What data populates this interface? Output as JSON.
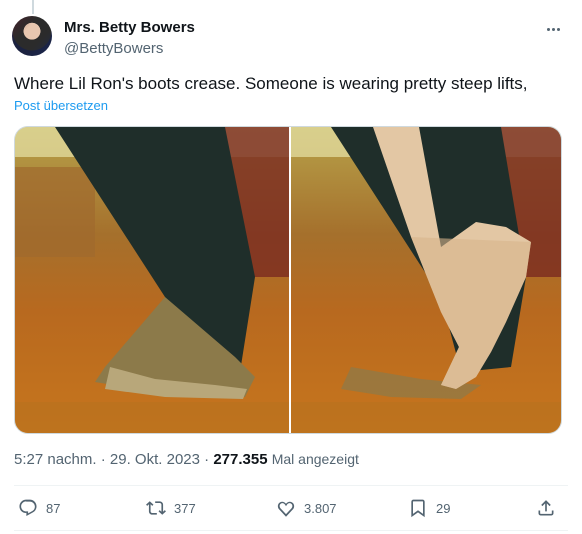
{
  "author": {
    "name": "Mrs. Betty Bowers",
    "handle": "@BettyBowers"
  },
  "tweet": {
    "text": "Where Lil Ron's boots crease. Someone is wearing pretty steep lifts,",
    "translate_label": "Post übersetzen"
  },
  "meta": {
    "time": "5:27 nachm.",
    "date": "29. Okt. 2023",
    "views": "277.355",
    "views_label": "Mal angezeigt"
  },
  "actions": {
    "replies": "87",
    "reposts": "377",
    "likes": "3.807",
    "bookmarks": "29"
  },
  "icons": [
    "more-icon",
    "reply-icon",
    "repost-icon",
    "like-icon",
    "bookmark-icon",
    "share-icon"
  ],
  "colors": {
    "link": "#1d9bf0",
    "secondary_text": "#536471",
    "primary_text": "#0f1419"
  }
}
